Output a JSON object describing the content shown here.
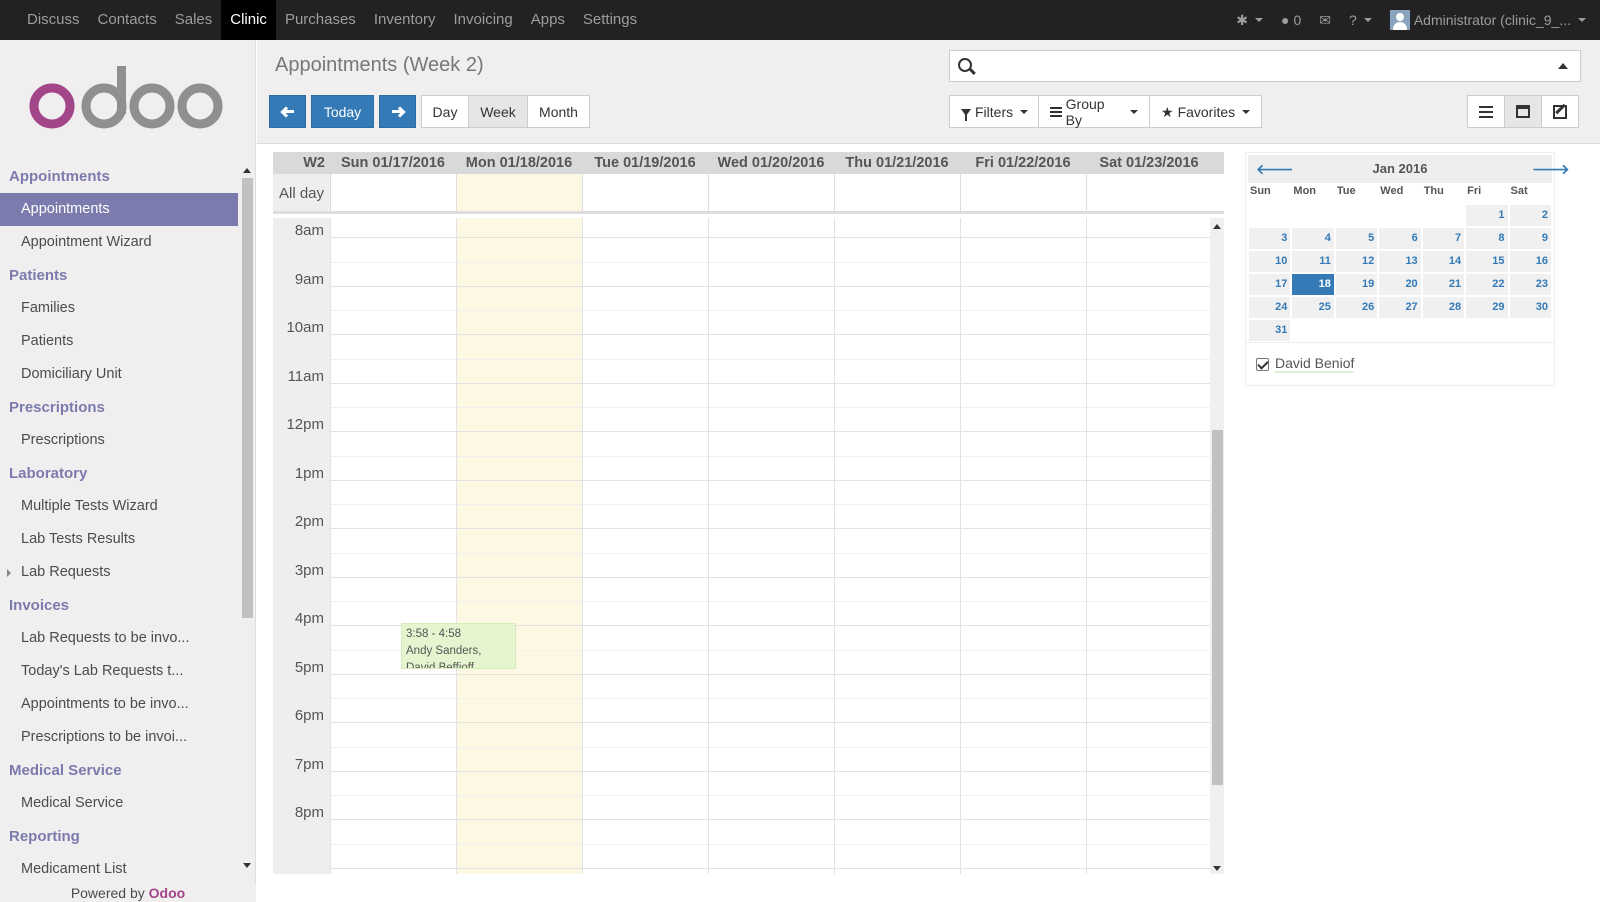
{
  "topbar": {
    "menu": [
      "Discuss",
      "Contacts",
      "Sales",
      "Clinic",
      "Purchases",
      "Inventory",
      "Invoicing",
      "Apps",
      "Settings"
    ],
    "active_menu": "Clinic",
    "chat_count": "0",
    "user": "Administrator (clinic_9_..."
  },
  "sidebar": {
    "logo_text": "odoo",
    "sections": [
      {
        "title": "Appointments",
        "items": [
          "Appointments",
          "Appointment Wizard"
        ]
      },
      {
        "title": "Patients",
        "items": [
          "Families",
          "Patients",
          "Domiciliary Unit"
        ]
      },
      {
        "title": "Prescriptions",
        "items": [
          "Prescriptions"
        ]
      },
      {
        "title": "Laboratory",
        "items": [
          "Multiple Tests Wizard",
          "Lab Tests Results",
          "Lab Requests"
        ]
      },
      {
        "title": "Invoices",
        "items": [
          "Lab Requests to be invo...",
          "Today's Lab Requests t...",
          "Appointments to be invo...",
          "Prescriptions to be invoi..."
        ]
      },
      {
        "title": "Medical Service",
        "items": [
          "Medical Service"
        ]
      },
      {
        "title": "Reporting",
        "items": [
          "Medicament List"
        ]
      }
    ],
    "active_item": "Appointments",
    "powered_prefix": "Powered by",
    "powered_brand": "Odoo"
  },
  "header": {
    "title": "Appointments (Week 2)",
    "today_label": "Today",
    "view_modes": [
      "Day",
      "Week",
      "Month"
    ],
    "active_mode": "Week",
    "search_placeholder": "",
    "filters_label": "Filters",
    "groupby_label": "Group By",
    "favorites_label": "Favorites"
  },
  "calendar": {
    "week_label": "W2",
    "days": [
      "Sun 01/17/2016",
      "Mon 01/18/2016",
      "Tue 01/19/2016",
      "Wed 01/20/2016",
      "Thu 01/21/2016",
      "Fri 01/22/2016",
      "Sat 01/23/2016"
    ],
    "allday_label": "All day",
    "hours": [
      "8am",
      "9am",
      "10am",
      "11am",
      "12pm",
      "1pm",
      "2pm",
      "3pm",
      "4pm",
      "5pm",
      "6pm",
      "7pm",
      "8pm"
    ],
    "event": {
      "time": "3:58 - 4:58",
      "line1": "Andy Sanders,",
      "line2": "David Beffioff"
    }
  },
  "mini_calendar": {
    "month": "Jan 2016",
    "dow": [
      "Sun",
      "Mon",
      "Tue",
      "Wed",
      "Thu",
      "Fri",
      "Sat"
    ],
    "weeks": [
      [
        "",
        "",
        "",
        "",
        "",
        "1",
        "2"
      ],
      [
        "3",
        "4",
        "5",
        "6",
        "7",
        "8",
        "9"
      ],
      [
        "10",
        "11",
        "12",
        "13",
        "14",
        "15",
        "16"
      ],
      [
        "17",
        "18",
        "19",
        "20",
        "21",
        "22",
        "23"
      ],
      [
        "24",
        "25",
        "26",
        "27",
        "28",
        "29",
        "30"
      ],
      [
        "31",
        "",
        "",
        "",
        "",
        "",
        ""
      ]
    ],
    "selected": "18"
  },
  "attendee": {
    "name": "David Beniof"
  }
}
